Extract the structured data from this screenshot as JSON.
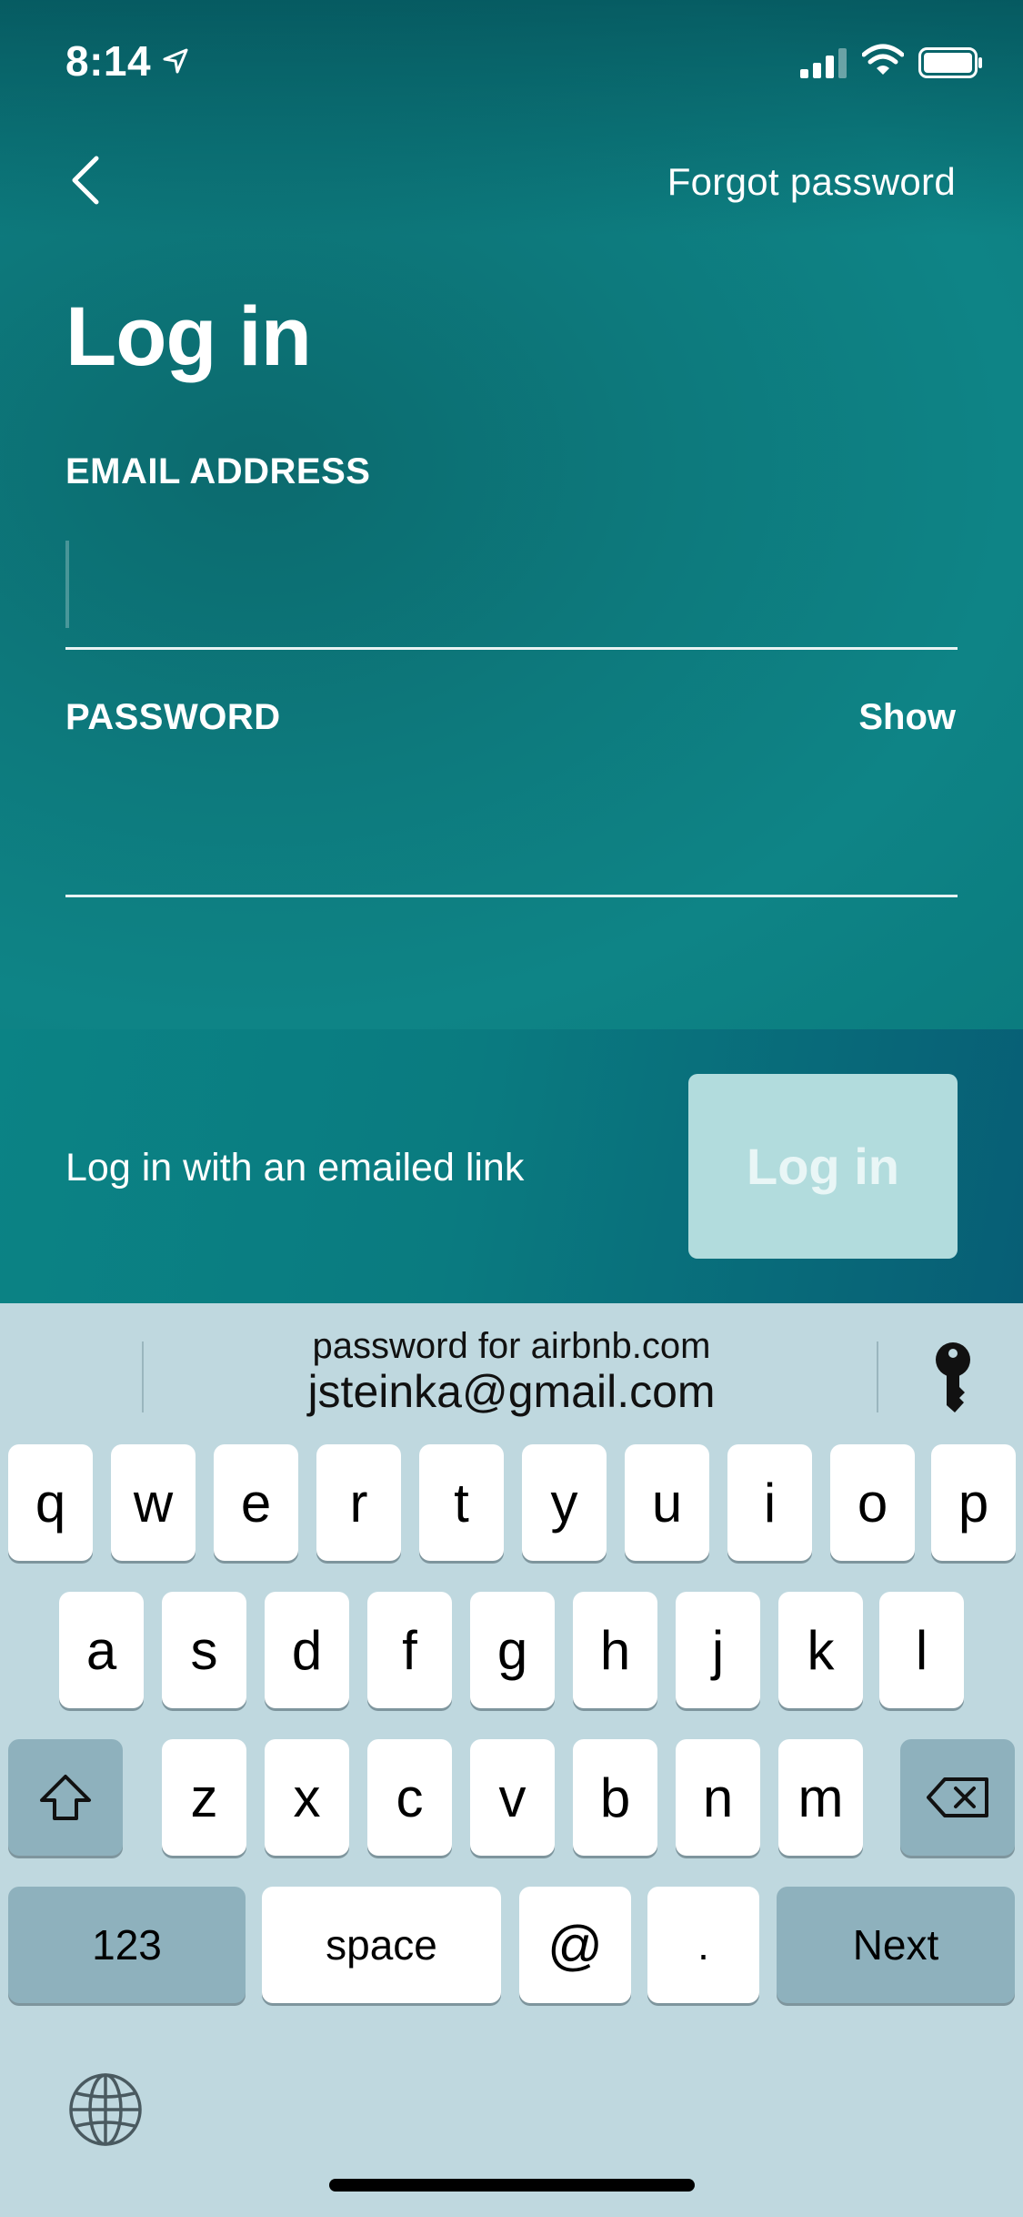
{
  "status_bar": {
    "time": "8:14",
    "icons": [
      "location-arrow-icon",
      "cellular-signal-icon",
      "wifi-icon",
      "battery-icon"
    ]
  },
  "header": {
    "back_icon": "chevron-left-icon",
    "forgot_password": "Forgot password"
  },
  "form": {
    "title": "Log in",
    "email_label": "EMAIL ADDRESS",
    "email_value": "",
    "password_label": "PASSWORD",
    "password_value": "",
    "show_toggle": "Show"
  },
  "actions": {
    "emailed_link": "Log in with an emailed link",
    "login_button": "Log in"
  },
  "keyboard": {
    "suggestion_sub": "password for airbnb.com",
    "suggestion_main": "jsteinka@gmail.com",
    "row1": [
      "q",
      "w",
      "e",
      "r",
      "t",
      "y",
      "u",
      "i",
      "o",
      "p"
    ],
    "row2": [
      "a",
      "s",
      "d",
      "f",
      "g",
      "h",
      "j",
      "k",
      "l"
    ],
    "row3": [
      "z",
      "x",
      "c",
      "v",
      "b",
      "n",
      "m"
    ],
    "numbers_key": "123",
    "space_key": "space",
    "at_key": "@",
    "dot_key": ".",
    "next_key": "Next",
    "icons": [
      "key-icon",
      "shift-icon",
      "backspace-icon",
      "globe-icon"
    ]
  },
  "colors": {
    "teal_background": "#0d7a7d",
    "login_button_bg": "#b2dcdd",
    "keyboard_bg": "#bfd8df",
    "function_key_bg": "#8eb1bd"
  }
}
